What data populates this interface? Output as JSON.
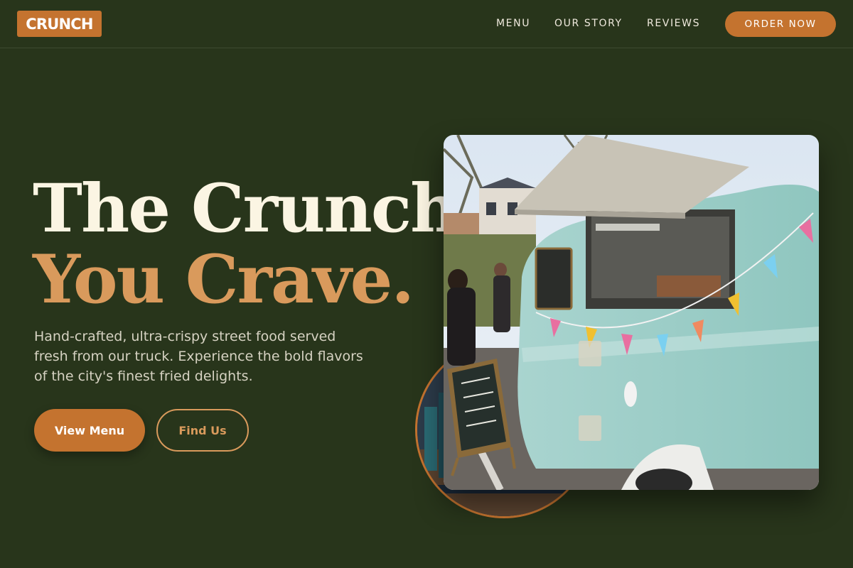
{
  "nav": {
    "logo": "CRUNCH",
    "links": [
      "MENU",
      "OUR STORY",
      "REVIEWS"
    ],
    "cta": "ORDER NOW"
  },
  "hero": {
    "title_line1": "The Crunch",
    "title_line2": "You Crave.",
    "subtitle": "Hand-crafted, ultra-crispy street food served fresh from our truck. Experience the bold flavors of the city's finest fried delights.",
    "primary_button": "View Menu",
    "secondary_button": "Find Us"
  },
  "images": {
    "main": "food-truck-photo",
    "secondary": "street-scene-photo"
  },
  "colors": {
    "background": "#28351b",
    "accent": "#c4732f",
    "accent_light": "#d99a5c",
    "cream": "#fbf5e3"
  }
}
